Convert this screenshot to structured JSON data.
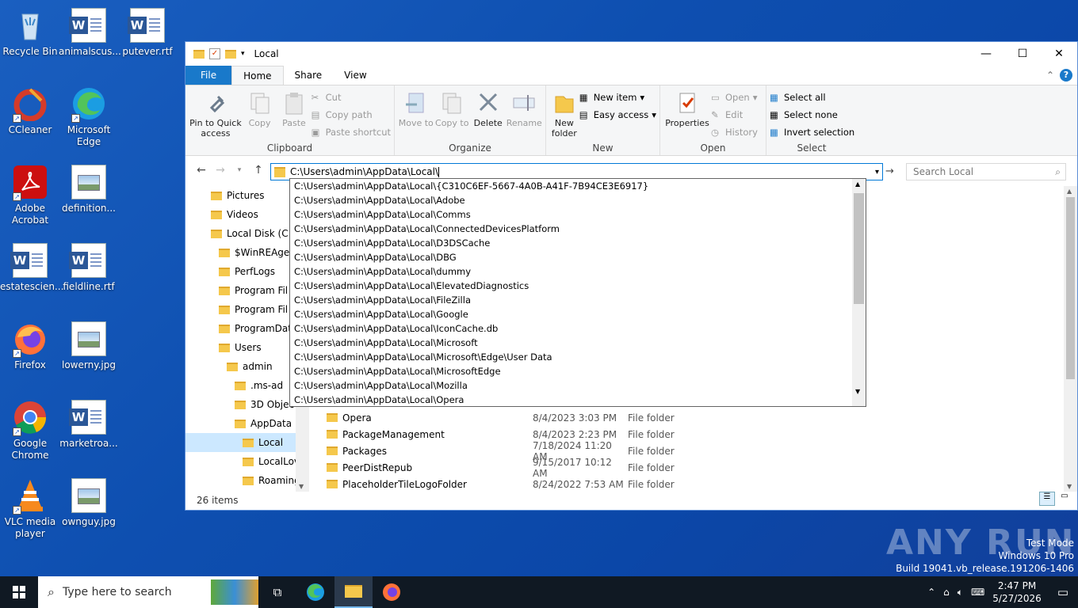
{
  "desktop": {
    "icons": [
      {
        "label": "Recycle Bin",
        "icon": "recycle-bin-icon"
      },
      {
        "label": "animalscus...",
        "icon": "word-doc-icon"
      },
      {
        "label": "putever.rtf",
        "icon": "word-doc-icon"
      },
      {
        "label": "CCleaner",
        "icon": "ccleaner-icon"
      },
      {
        "label": "Microsoft Edge",
        "icon": "edge-icon"
      },
      {
        "label": "Adobe Acrobat",
        "icon": "acrobat-icon"
      },
      {
        "label": "definition...",
        "icon": "image-file-icon"
      },
      {
        "label": "estatescien...",
        "icon": "word-doc-icon"
      },
      {
        "label": "fieldline.rtf",
        "icon": "word-doc-icon"
      },
      {
        "label": "Firefox",
        "icon": "firefox-icon"
      },
      {
        "label": "lowerny.jpg",
        "icon": "image-file-icon"
      },
      {
        "label": "Google Chrome",
        "icon": "chrome-icon"
      },
      {
        "label": "marketroa...",
        "icon": "word-doc-icon"
      },
      {
        "label": "VLC media player",
        "icon": "vlc-icon"
      },
      {
        "label": "ownguy.jpg",
        "icon": "image-file-icon"
      }
    ]
  },
  "window": {
    "title": "Local",
    "tabs": {
      "file": "File",
      "home": "Home",
      "share": "Share",
      "view": "View"
    },
    "ribbon": {
      "clipboard": {
        "label": "Clipboard",
        "pin": "Pin to Quick access",
        "copy": "Copy",
        "paste": "Paste",
        "cut": "Cut",
        "copy_path": "Copy path",
        "paste_shortcut": "Paste shortcut"
      },
      "organize": {
        "label": "Organize",
        "move_to": "Move to",
        "copy_to": "Copy to",
        "delete": "Delete",
        "rename": "Rename"
      },
      "new": {
        "label": "New",
        "new_folder": "New folder",
        "new_item": "New item",
        "easy_access": "Easy access"
      },
      "open": {
        "label": "Open",
        "properties": "Properties",
        "open": "Open",
        "edit": "Edit",
        "history": "History"
      },
      "select": {
        "label": "Select",
        "select_all": "Select all",
        "select_none": "Select none",
        "invert": "Invert selection"
      }
    },
    "address": "C:\\Users\\admin\\AppData\\Local\\",
    "search_placeholder": "Search Local",
    "nav": [
      {
        "label": "Pictures",
        "indent": 1
      },
      {
        "label": "Videos",
        "indent": 1
      },
      {
        "label": "Local Disk (C:",
        "indent": 1
      },
      {
        "label": "$WinREAge",
        "indent": 2
      },
      {
        "label": "PerfLogs",
        "indent": 2
      },
      {
        "label": "Program Fil",
        "indent": 2
      },
      {
        "label": "Program Fil",
        "indent": 2
      },
      {
        "label": "ProgramDat",
        "indent": 2
      },
      {
        "label": "Users",
        "indent": 2
      },
      {
        "label": "admin",
        "indent": 3
      },
      {
        "label": ".ms-ad",
        "indent": 4
      },
      {
        "label": "3D Objec",
        "indent": 4
      },
      {
        "label": "AppData",
        "indent": 4
      },
      {
        "label": "Local",
        "indent": 5
      },
      {
        "label": "LocalLov",
        "indent": 5
      },
      {
        "label": "Roaming",
        "indent": 5
      }
    ],
    "files": [
      {
        "name": "Opera",
        "date": "8/4/2023 3:03 PM",
        "type": "File folder"
      },
      {
        "name": "PackageManagement",
        "date": "8/4/2023 2:23 PM",
        "type": "File folder"
      },
      {
        "name": "Packages",
        "date": "7/18/2024 11:20 AM",
        "type": "File folder"
      },
      {
        "name": "PeerDistRepub",
        "date": "9/15/2017 10:12 AM",
        "type": "File folder"
      },
      {
        "name": "PlaceholderTileLogoFolder",
        "date": "8/24/2022 7:53 AM",
        "type": "File folder"
      }
    ],
    "status": "26 items",
    "autocomplete": [
      "C:\\Users\\admin\\AppData\\Local\\{C310C6EF-5667-4A0B-A41F-7B94CE3E6917}",
      "C:\\Users\\admin\\AppData\\Local\\Adobe",
      "C:\\Users\\admin\\AppData\\Local\\Comms",
      "C:\\Users\\admin\\AppData\\Local\\ConnectedDevicesPlatform",
      "C:\\Users\\admin\\AppData\\Local\\D3DSCache",
      "C:\\Users\\admin\\AppData\\Local\\DBG",
      "C:\\Users\\admin\\AppData\\Local\\dummy",
      "C:\\Users\\admin\\AppData\\Local\\ElevatedDiagnostics",
      "C:\\Users\\admin\\AppData\\Local\\FileZilla",
      "C:\\Users\\admin\\AppData\\Local\\Google",
      "C:\\Users\\admin\\AppData\\Local\\IconCache.db",
      "C:\\Users\\admin\\AppData\\Local\\Microsoft",
      "C:\\Users\\admin\\AppData\\Local\\Microsoft\\Edge\\User Data",
      "C:\\Users\\admin\\AppData\\Local\\MicrosoftEdge",
      "C:\\Users\\admin\\AppData\\Local\\Mozilla",
      "C:\\Users\\admin\\AppData\\Local\\Opera"
    ]
  },
  "taskbar": {
    "search_placeholder": "Type here to search",
    "time": "2:47 PM",
    "date": "5/27/2026"
  },
  "watermark": {
    "line1": "Test Mode",
    "line2": "Windows 10 Pro",
    "line3": "Build 19041.vb_release.191206-1406",
    "brand": "ANY RUN"
  }
}
